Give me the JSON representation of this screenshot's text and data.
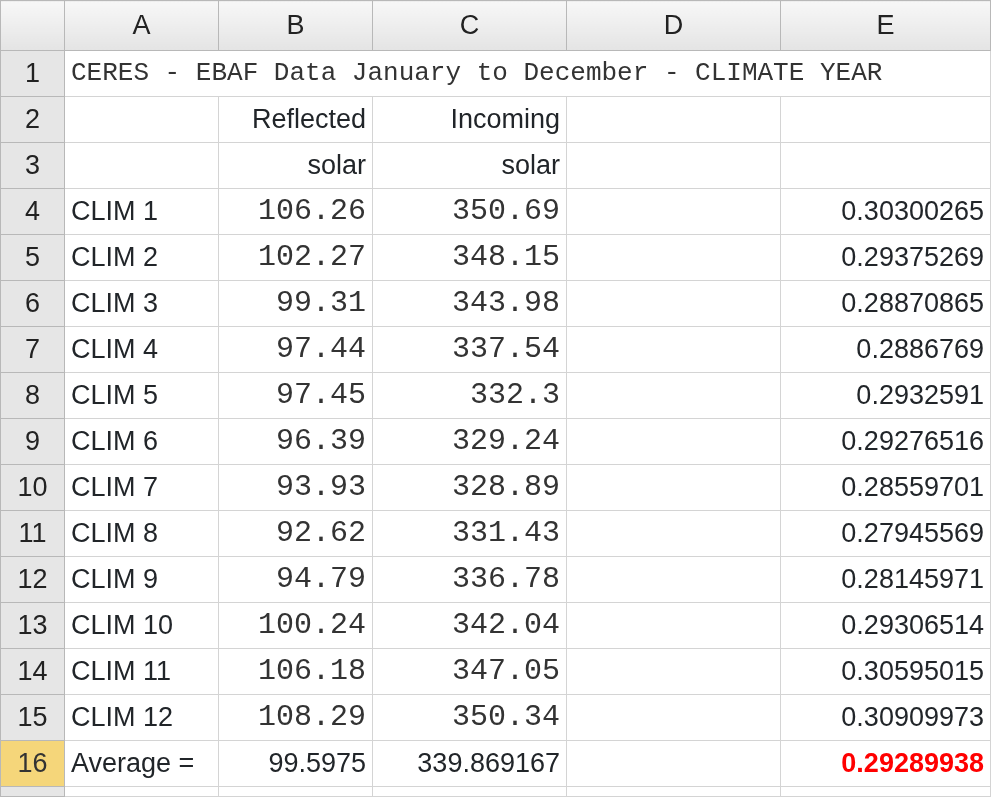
{
  "columns": [
    {
      "label": "A",
      "selected": false
    },
    {
      "label": "B",
      "selected": false
    },
    {
      "label": "C",
      "selected": false
    },
    {
      "label": "D",
      "selected": false
    },
    {
      "label": "E",
      "selected": false
    }
  ],
  "rows": [
    {
      "number": "1",
      "selected": false,
      "column_a": {
        "kind": "title",
        "text": "CERES - EBAF Data January to December - CLIMATE YEAR"
      }
    },
    {
      "number": "2",
      "selected": false,
      "column_b": {
        "kind": "number",
        "text": "Reflected"
      },
      "column_c": {
        "kind": "number",
        "text": "Incoming"
      }
    },
    {
      "number": "3",
      "selected": false,
      "column_b": {
        "kind": "number",
        "text": "solar"
      },
      "column_c": {
        "kind": "number",
        "text": "solar"
      }
    },
    {
      "number": "4",
      "selected": false,
      "column_a": {
        "kind": "label",
        "text": "CLIM 1"
      },
      "column_b": {
        "kind": "mono",
        "text": "106.26"
      },
      "column_c": {
        "kind": "mono",
        "text": "350.69"
      },
      "column_e": {
        "kind": "number",
        "text": "0.30300265"
      }
    },
    {
      "number": "5",
      "selected": false,
      "column_a": {
        "kind": "label",
        "text": "CLIM 2"
      },
      "column_b": {
        "kind": "mono",
        "text": "102.27"
      },
      "column_c": {
        "kind": "mono",
        "text": "348.15"
      },
      "column_e": {
        "kind": "number",
        "text": "0.29375269"
      }
    },
    {
      "number": "6",
      "selected": false,
      "column_a": {
        "kind": "label",
        "text": "CLIM 3"
      },
      "column_b": {
        "kind": "mono",
        "text": "99.31"
      },
      "column_c": {
        "kind": "mono",
        "text": "343.98"
      },
      "column_e": {
        "kind": "number",
        "text": "0.28870865"
      }
    },
    {
      "number": "7",
      "selected": false,
      "column_a": {
        "kind": "label",
        "text": "CLIM 4"
      },
      "column_b": {
        "kind": "mono",
        "text": "97.44"
      },
      "column_c": {
        "kind": "mono",
        "text": "337.54"
      },
      "column_e": {
        "kind": "number",
        "text": "0.2886769"
      }
    },
    {
      "number": "8",
      "selected": false,
      "column_a": {
        "kind": "label",
        "text": "CLIM 5"
      },
      "column_b": {
        "kind": "mono",
        "text": "97.45"
      },
      "column_c": {
        "kind": "mono",
        "text": "332.3"
      },
      "column_e": {
        "kind": "number",
        "text": "0.2932591"
      }
    },
    {
      "number": "9",
      "selected": false,
      "column_a": {
        "kind": "label",
        "text": "CLIM 6"
      },
      "column_b": {
        "kind": "mono",
        "text": "96.39"
      },
      "column_c": {
        "kind": "mono",
        "text": "329.24"
      },
      "column_e": {
        "kind": "number",
        "text": "0.29276516"
      }
    },
    {
      "number": "10",
      "selected": false,
      "column_a": {
        "kind": "label",
        "text": "CLIM 7"
      },
      "column_b": {
        "kind": "mono",
        "text": "93.93"
      },
      "column_c": {
        "kind": "mono",
        "text": "328.89"
      },
      "column_e": {
        "kind": "number",
        "text": "0.28559701"
      }
    },
    {
      "number": "11",
      "selected": false,
      "column_a": {
        "kind": "label",
        "text": "CLIM 8"
      },
      "column_b": {
        "kind": "mono",
        "text": "92.62"
      },
      "column_c": {
        "kind": "mono",
        "text": "331.43"
      },
      "column_e": {
        "kind": "number",
        "text": "0.27945569"
      }
    },
    {
      "number": "12",
      "selected": false,
      "column_a": {
        "kind": "label",
        "text": "CLIM 9"
      },
      "column_b": {
        "kind": "mono",
        "text": "94.79"
      },
      "column_c": {
        "kind": "mono",
        "text": "336.78"
      },
      "column_e": {
        "kind": "number",
        "text": "0.28145971"
      }
    },
    {
      "number": "13",
      "selected": false,
      "column_a": {
        "kind": "label",
        "text": "CLIM 10"
      },
      "column_b": {
        "kind": "mono",
        "text": "100.24"
      },
      "column_c": {
        "kind": "mono",
        "text": "342.04"
      },
      "column_e": {
        "kind": "number",
        "text": "0.29306514"
      }
    },
    {
      "number": "14",
      "selected": false,
      "column_a": {
        "kind": "label",
        "text": "CLIM 11"
      },
      "column_b": {
        "kind": "mono",
        "text": "106.18"
      },
      "column_c": {
        "kind": "mono",
        "text": "347.05"
      },
      "column_e": {
        "kind": "number",
        "text": "0.30595015"
      }
    },
    {
      "number": "15",
      "selected": false,
      "column_a": {
        "kind": "label",
        "text": "CLIM 12"
      },
      "column_b": {
        "kind": "mono",
        "text": "108.29"
      },
      "column_c": {
        "kind": "mono",
        "text": "350.34"
      },
      "column_e": {
        "kind": "number",
        "text": "0.30909973"
      }
    },
    {
      "number": "16",
      "selected": true,
      "column_a": {
        "kind": "label",
        "text": "Average ="
      },
      "column_b": {
        "kind": "number",
        "text": "99.5975"
      },
      "column_c": {
        "kind": "number",
        "text": "339.869167"
      },
      "column_e": {
        "kind": "alert",
        "text": "0.29289938"
      }
    }
  ]
}
